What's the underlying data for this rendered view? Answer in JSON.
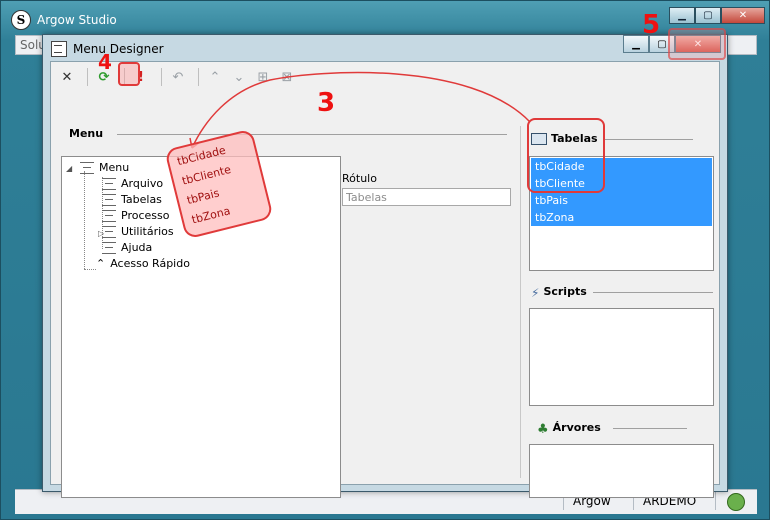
{
  "background_window": {
    "title": "Argow Studio",
    "menu_text": "Solu",
    "status": {
      "user": "Argow",
      "db": "ARDEMO"
    }
  },
  "dialog": {
    "title": "Menu Designer"
  },
  "toolbar": {
    "icons": [
      "close-icon",
      "refresh-icon",
      "warning-icon",
      "undo-icon",
      "move-up-icon",
      "move-down-icon",
      "add-item-icon",
      "remove-item-icon"
    ]
  },
  "menu_panel": {
    "header": "Menu",
    "tree": {
      "root": "Menu",
      "children": [
        "Arquivo",
        "Tabelas",
        "Processo",
        "Utilitários",
        "Ajuda"
      ],
      "sibling": "Acesso Rápido"
    }
  },
  "properties": {
    "label": "Rótulo",
    "value": "Tabelas"
  },
  "tabelas_panel": {
    "header": "Tabelas",
    "items": [
      "tbCidade",
      "tbCliente",
      "tbPais",
      "tbZona"
    ]
  },
  "scripts_panel": {
    "header": "Scripts"
  },
  "arvores_panel": {
    "header": "Árvores"
  },
  "annotations": {
    "step3": "3",
    "step4": "4",
    "step5": "5",
    "callout_items": [
      "tbCidade",
      "tbCliente",
      "tbPais",
      "tbZona"
    ]
  },
  "colors": {
    "selection": "#3399ff",
    "annotation": "#e03a3a"
  }
}
